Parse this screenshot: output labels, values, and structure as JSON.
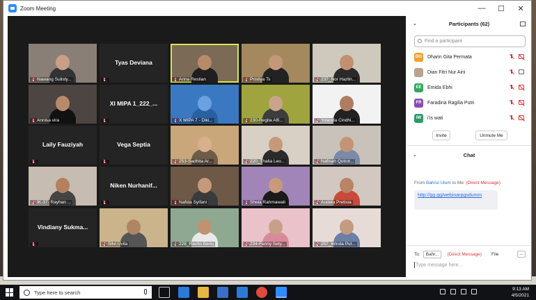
{
  "window": {
    "title": "Zoom Meeting",
    "minimize": "—",
    "maximize": "☐",
    "close": "✕"
  },
  "tiles": [
    {
      "name": "Nawang Sulisty...",
      "type": "photo",
      "bg": "#8a7f76",
      "skin": "#c9a085",
      "cloth": "#333"
    },
    {
      "name": "Tyas Deviana",
      "type": "text"
    },
    {
      "name": "Arina Restian",
      "type": "photo",
      "bg": "#7b6a55",
      "skin": "#b98a6a",
      "cloth": "#1f1f1f",
      "active": true
    },
    {
      "name": "Pristiya Ts",
      "type": "photo",
      "bg": "#a4895f",
      "skin": "#c49778",
      "cloth": "#222"
    },
    {
      "name": "237_Nor Hazlin...",
      "type": "photo",
      "bg": "#cfc9bd",
      "skin": "#c09070",
      "cloth": "#2a2a2a"
    },
    {
      "name": "Annisa vira",
      "type": "photo",
      "bg": "#4d4541",
      "skin": "#b88a6c",
      "cloth": "#111"
    },
    {
      "name": "XI MIPA 1_222_...",
      "type": "text"
    },
    {
      "name": "X MIPA 7 - Diki...",
      "type": "photo",
      "bg": "#3b78c2",
      "skin": "#6aa1e0",
      "cloth": "#2a5fa0"
    },
    {
      "name": "230-Regita Alfi...",
      "type": "photo",
      "bg": "#9fa43e",
      "skin": "#c9a48a",
      "cloth": "#3d3d3d"
    },
    {
      "name": "Yolanda Cindhi...",
      "type": "photo",
      "bg": "#f2f2f2",
      "skin": "#b07d63",
      "cloth": "#222"
    },
    {
      "name": "Laily Fauziyah",
      "type": "text"
    },
    {
      "name": "Vega Septia",
      "type": "text"
    },
    {
      "name": "253-Sadhita Ar...",
      "type": "photo",
      "bg": "#c9a77b",
      "skin": "#d8b08e",
      "cloth": "#6f5b4a"
    },
    {
      "name": "220_Thalia Leo...",
      "type": "photo",
      "bg": "#d8cfc5",
      "skin": "#c5997a",
      "cloth": "#2b2b2b"
    },
    {
      "name": "Nafisah Qotrot...",
      "type": "photo",
      "bg": "#c9c2bb",
      "skin": "#c29476",
      "cloth": "#7a8aa8"
    },
    {
      "name": "IK-37- Rayhan ...",
      "type": "photo",
      "bg": "#c7bcb1",
      "skin": "#b5805f",
      "cloth": "#444"
    },
    {
      "name": "Niken Nurhanif...",
      "type": "text"
    },
    {
      "name": "Nafida Syifani",
      "type": "photo",
      "bg": "#6e5846",
      "skin": "#c59a7a",
      "cloth": "#3a3a3a"
    },
    {
      "name": "Shela Rahmawati",
      "type": "photo",
      "bg": "#a285b8",
      "skin": "#c79a7c",
      "cloth": "#1a1a1a"
    },
    {
      "name": "Audela Pretisia",
      "type": "photo",
      "bg": "#d3c7c2",
      "skin": "#ba8466",
      "cloth": "#c84a3a"
    },
    {
      "name": "Vindiany  Sukma...",
      "type": "text"
    },
    {
      "name": "Silvi Uvila",
      "type": "photo",
      "bg": "#cbb48c",
      "skin": "#b08566",
      "cloth": "#555"
    },
    {
      "name": "228_Ravito Bariq",
      "type": "photo",
      "bg": "#8fa892",
      "skin": "#c09272",
      "cloth": "#e9e9e9"
    },
    {
      "name": "234-Fenny Sety...",
      "type": "photo",
      "bg": "#e9c3c9",
      "skin": "#c8a08a",
      "cloth": "#d98a9a"
    },
    {
      "name": "257_Winda Put...",
      "type": "photo",
      "bg": "#e6dbd6",
      "skin": "#c49a80",
      "cloth": "#6c7fa6"
    }
  ],
  "participants": {
    "header": "Participants (62)",
    "search_placeholder": "Find a participant",
    "list": [
      {
        "initials": "DG",
        "color": "#f0a030",
        "name": "Dharin Gita Permata",
        "cam": "off"
      },
      {
        "initials": "",
        "color": "#b9a38e",
        "name": "Dian Fitri Nur Aini",
        "cam": "on"
      },
      {
        "initials": "EE",
        "color": "#2faa5a",
        "name": "Emida Ebhi",
        "cam": "off"
      },
      {
        "initials": "FR",
        "color": "#8a4ab3",
        "name": "Faradina Ragilia Putri",
        "cam": "off"
      },
      {
        "initials": "IW",
        "color": "#2a9a6a",
        "name": "i'is wati",
        "cam": "off"
      }
    ],
    "invite": "Invite",
    "unmute": "Unmute Me"
  },
  "chat": {
    "header": "Chat",
    "from_prefix": "From",
    "from_who": "Bahrul Ulum",
    "from_mid": "to Me:",
    "from_dm": "(Direct Message)",
    "message": "http://gg.gg/webinarpgsdumm",
    "to_label": "To:",
    "to_value": "Bahr...",
    "to_dm": "(Direct Message)",
    "file": "File",
    "more": "...",
    "placeholder": "Type message here..."
  },
  "taskbar": {
    "search": "Type here to search",
    "time": "9:13 AM",
    "date": "4/5/2021"
  }
}
